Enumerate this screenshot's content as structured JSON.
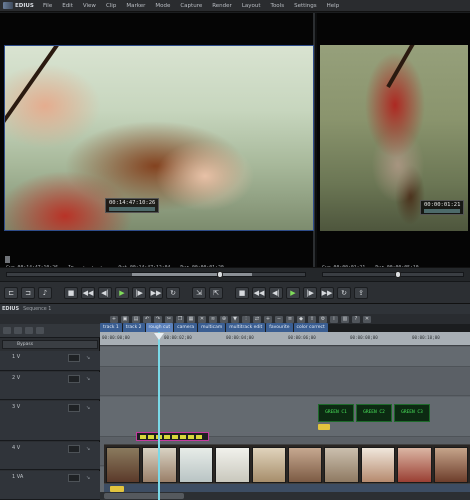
{
  "app": {
    "name": "EDIUS"
  },
  "menu": [
    "File",
    "Edit",
    "View",
    "Clip",
    "Marker",
    "Mode",
    "Capture",
    "Render",
    "Layout",
    "Tools",
    "Settings",
    "Help"
  ],
  "player": {
    "overlay_tc": "00:14:47:10:26",
    "info": [
      "Cur 00:14:47:10:26",
      "In --:--:--:--",
      "Out 00:14:47:12:04",
      "Dur 00:00:01:20"
    ]
  },
  "recorder": {
    "overlay_tc": "00:00:01:21",
    "info": [
      "Cur 00:00:01:21",
      "Dur 00:00:05:10"
    ]
  },
  "timeline": {
    "window_title": "EDIUS",
    "sequence": "Sequence 1",
    "settings_label": "Bypass",
    "tabs": [
      "track 1",
      "track 2",
      "rough cut",
      "camera",
      "multicam",
      "multitrack edit",
      "favourite",
      "color correct"
    ],
    "tracks": [
      {
        "label": "1 V"
      },
      {
        "label": "2 V"
      },
      {
        "label": "3 V"
      },
      {
        "label": "4 V"
      },
      {
        "label": "1 VA"
      }
    ],
    "ruler_ticks": [
      "00:00:00;00",
      "00:00:02;00",
      "00:00:04;00",
      "00:00:06;00",
      "00:00:08;00",
      "00:00:10;00"
    ],
    "green_clips": [
      "GREEN C1",
      "GREEN C2",
      "GREEN C3"
    ]
  },
  "colors": {
    "accent": "#3a5e92",
    "playhead": "#7ad9e8",
    "title_clip_border": "#c53aa0"
  }
}
